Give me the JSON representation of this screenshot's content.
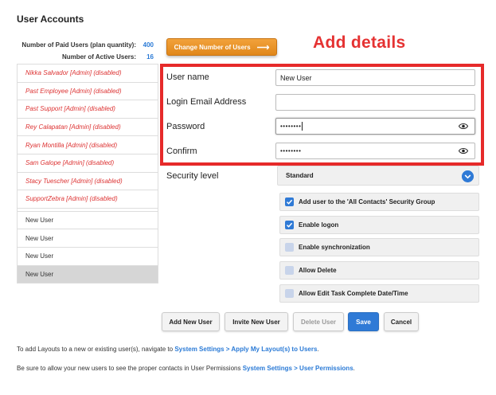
{
  "page": {
    "title": "User Accounts"
  },
  "stats": {
    "paid_label": "Number of Paid Users (plan quantity):",
    "paid_value": "400",
    "active_label": "Number of Active Users:",
    "active_value": "16"
  },
  "users": {
    "disabled": [
      "Nikka Salvador [Admin] (disabled)",
      "Past Employee [Admin] (disabled)",
      "Past Support [Admin] (disabled)",
      "Rey Calapatan [Admin] (disabled)",
      "Ryan Montilla [Admin] (disabled)",
      "Sam Galope [Admin] (disabled)",
      "Stacy Tuescher [Admin] (disabled)",
      "SupportZebra [Admin] (disabled)"
    ],
    "new": [
      "New User",
      "New User",
      "New User",
      "New User"
    ]
  },
  "change_button": {
    "label": "Change Number of Users",
    "icon": "arrow-right-icon"
  },
  "annotation": "Add details",
  "form": {
    "username_label": "User name",
    "username_value": "New User",
    "email_label": "Login Email Address",
    "email_value": "",
    "password_label": "Password",
    "password_value": "••••••••",
    "confirm_label": "Confirm",
    "confirm_value": "••••••••",
    "security_label": "Security level",
    "security_value": "Standard"
  },
  "checks": [
    {
      "label": "Add user to the 'All Contacts' Security Group",
      "checked": true
    },
    {
      "label": "Enable logon",
      "checked": true
    },
    {
      "label": "Enable synchronization",
      "checked": false
    },
    {
      "label": "Allow Delete",
      "checked": false
    },
    {
      "label": "Allow Edit Task Complete Date/Time",
      "checked": false
    }
  ],
  "buttons": {
    "add": "Add New User",
    "invite": "Invite New User",
    "delete": "Delete User",
    "save": "Save",
    "cancel": "Cancel"
  },
  "notes": {
    "layouts_text": "To add Layouts to a new or existing user(s), navigate to ",
    "layouts_link": "System Settings > Apply My Layout(s) to Users",
    "layouts_end": ".",
    "perm_text": "Be sure to allow your new users to see the proper contacts in User Permissions ",
    "perm_link": "System Settings > User Permissions",
    "perm_end": "."
  },
  "colors": {
    "accent": "#2f7ad6",
    "annotation": "#e53232",
    "orange": "#e8951f"
  }
}
